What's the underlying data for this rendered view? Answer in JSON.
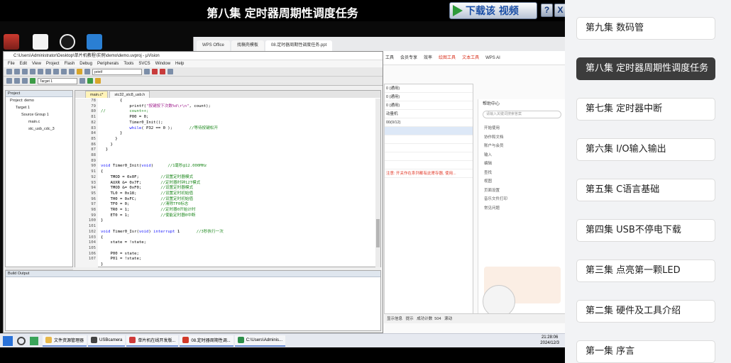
{
  "player": {
    "title": "第八集 定时器周期性调度任务",
    "download_label": "下载该 视频",
    "help_label": "?",
    "close_label": "X"
  },
  "uvision": {
    "title": "C:\\Users\\Administrator\\Desktop\\单片机教程\\实例\\demo\\demo.uvproj - µVision",
    "menu": [
      "File",
      "Edit",
      "View",
      "Project",
      "Flash",
      "Debug",
      "Peripherals",
      "Tools",
      "SVCS",
      "Window",
      "Help"
    ],
    "target_combo": "Target 1",
    "find_combo": "printf",
    "project_header": "Project",
    "tree": [
      "Project: demo",
      "Target 1",
      "Source Group 1",
      "main.c",
      "stc_usb_cdc_3"
    ],
    "tabs": [
      "main.c*",
      "stc32_stc8_usb.h"
    ],
    "gutter": [
      "78",
      "79",
      "80",
      "81",
      "82",
      "83",
      "84",
      "85",
      "86",
      "87",
      "88",
      "89",
      "90",
      "91",
      "92",
      "93",
      "94",
      "95",
      "96",
      "97",
      "98",
      "99",
      "100",
      "101",
      "102",
      "103",
      "104",
      "105",
      "106",
      "107"
    ],
    "build_header": "Build Output"
  },
  "wps": {
    "tabs": [
      "WPS Office",
      "找稿壳模板",
      "08.定时器周期性调度任务.ppt"
    ],
    "ribbon": [
      "工具",
      "会员专享",
      "效率",
      "绘图工具",
      "文本工具",
      "WPS AI"
    ],
    "rules": [
      "0 (通用)",
      "0 (通用)",
      "0 (通用)",
      "动量机",
      "00(0/12)",
      "",
      "",
      "",
      "",
      "",
      "注意: 开关作在系列都有此寄存器, 使用..."
    ],
    "help_header": "帮助中心",
    "help_search": "请输入关键词搜索答案",
    "help_items": [
      "开始使用",
      "协作和文档",
      "账户与会员",
      "输入",
      "编辑",
      "查找",
      "视图",
      "页面设置",
      "音乐文件打印",
      "常见问题"
    ],
    "status_items": [
      "显示信息",
      "提示",
      "成功计数",
      "504",
      "滚动"
    ]
  },
  "taskbar": {
    "apps": [
      "文件资源管理器",
      "USBcamera",
      "单片机在线开发版...",
      "08.定时器周期性调...",
      "C:\\Users\\Adminis..."
    ],
    "time": "21:28:06",
    "date": "2024/12/3"
  },
  "episodes": [
    "第九集 数码管",
    "第八集 定时器周期性调度任务",
    "第七集 定时器中断",
    "第六集 I/O输入输出",
    "第五集 C语言基础",
    "第四集 USB不停电下载",
    "第三集 点亮第一颗LED",
    "第二集 硬件及工具介绍",
    "第一集 序言"
  ],
  "active_episode": "第八集 定时器周期性调度任务"
}
